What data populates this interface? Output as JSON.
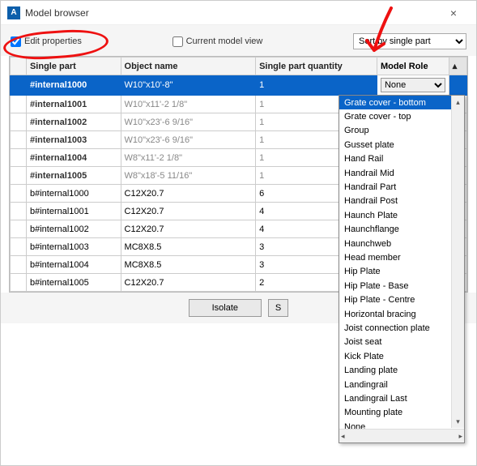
{
  "window": {
    "icon_letter": "A",
    "title": "Model browser",
    "close": "×"
  },
  "controls": {
    "edit_props": "Edit properties",
    "current_view": "Current model view",
    "sort_label": "Sort by single part"
  },
  "columns": {
    "single_part": "Single part",
    "object_name": "Object name",
    "quantity": "Single part quantity",
    "model_role": "Model Role"
  },
  "role_selected": "None",
  "rows": [
    {
      "sp": "#internal1000",
      "obj": "W10\"x10'-8\"",
      "qty": "1",
      "selected": true,
      "bold": true,
      "gray": false
    },
    {
      "sp": "#internal1001",
      "obj": "W10\"x11'-2 1/8\"",
      "qty": "1",
      "bold": true,
      "gray": true
    },
    {
      "sp": "#internal1002",
      "obj": "W10\"x23'-6 9/16\"",
      "qty": "1",
      "bold": true,
      "gray": true
    },
    {
      "sp": "#internal1003",
      "obj": "W10\"x23'-6 9/16\"",
      "qty": "1",
      "bold": true,
      "gray": true
    },
    {
      "sp": "#internal1004",
      "obj": "W8\"x11'-2 1/8\"",
      "qty": "1",
      "bold": true,
      "gray": true
    },
    {
      "sp": "#internal1005",
      "obj": "W8\"x18'-5 11/16\"",
      "qty": "1",
      "bold": true,
      "gray": true
    },
    {
      "sp": "b#internal1000",
      "obj": "C12X20.7",
      "qty": "6",
      "bold": false,
      "gray": false
    },
    {
      "sp": "b#internal1001",
      "obj": "C12X20.7",
      "qty": "4",
      "bold": false,
      "gray": false
    },
    {
      "sp": "b#internal1002",
      "obj": "C12X20.7",
      "qty": "4",
      "bold": false,
      "gray": false
    },
    {
      "sp": "b#internal1003",
      "obj": "MC8X8.5",
      "qty": "3",
      "bold": false,
      "gray": false
    },
    {
      "sp": "b#internal1004",
      "obj": "MC8X8.5",
      "qty": "3",
      "bold": false,
      "gray": false
    },
    {
      "sp": "b#internal1005",
      "obj": "C12X20.7",
      "qty": "2",
      "bold": false,
      "gray": false
    }
  ],
  "buttons": {
    "isolate": "Isolate",
    "second": "S"
  },
  "dropdown_items": [
    {
      "label": "Grate cover - bottom",
      "hl": true
    },
    {
      "label": "Grate cover - top"
    },
    {
      "label": "Group"
    },
    {
      "label": "Gusset plate"
    },
    {
      "label": "Hand Rail"
    },
    {
      "label": "Handrail Mid"
    },
    {
      "label": "Handrail Part"
    },
    {
      "label": "Handrail Post"
    },
    {
      "label": "Haunch Plate"
    },
    {
      "label": "Haunchflange"
    },
    {
      "label": "Haunchweb"
    },
    {
      "label": "Head member"
    },
    {
      "label": "Hip Plate"
    },
    {
      "label": "Hip Plate - Base"
    },
    {
      "label": "Hip Plate - Centre"
    },
    {
      "label": "Horizontal bracing"
    },
    {
      "label": "Joist connection plate"
    },
    {
      "label": "Joist seat"
    },
    {
      "label": "Kick Plate"
    },
    {
      "label": "Landing plate"
    },
    {
      "label": "Landingrail"
    },
    {
      "label": "Landingrail Last"
    },
    {
      "label": "Mounting plate"
    },
    {
      "label": "None"
    }
  ]
}
